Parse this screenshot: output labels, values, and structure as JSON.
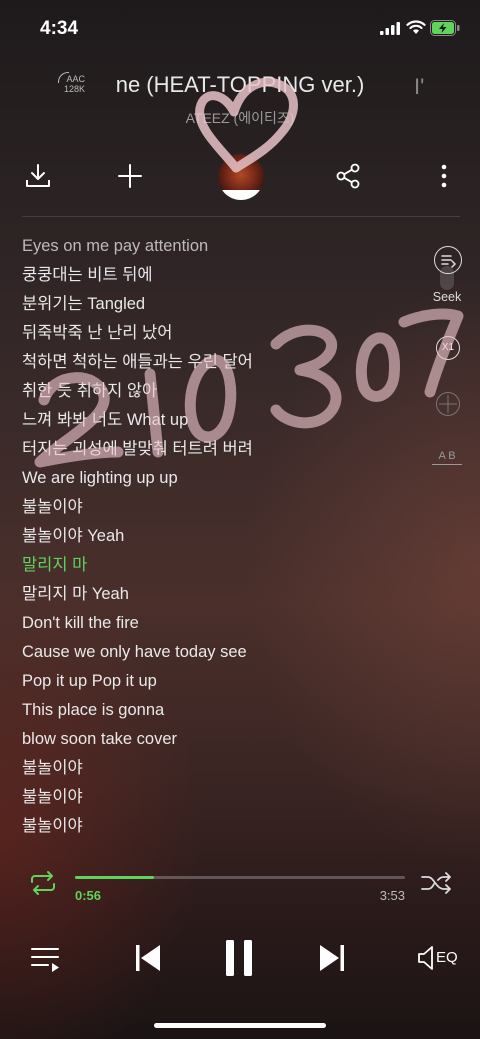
{
  "status_bar": {
    "time": "4:34"
  },
  "header": {
    "codec_line1": "AAC",
    "codec_line2": "128K",
    "title": "ne (HEAT-TOPPING ver.)",
    "title_fragment": "I'",
    "artist": "ATEEZ (에이티즈)"
  },
  "toolbar": {
    "download_icon": "download-icon",
    "add_icon": "plus-icon",
    "share_icon": "share-icon",
    "more_icon": "more-vertical-icon"
  },
  "lyrics": [
    "Eyes on me pay attention",
    "쿵쿵대는 비트 뒤에",
    "분위기는 Tangled",
    "뒤죽박죽 난 난리 났어",
    "척하면 척하는 애들과는 우린 달어",
    "취한 듯 취하지 않아",
    "느껴 봐봐 너도 What up",
    "터지는 괴성에 발맞춰 터트려 버려",
    "We are lighting up up",
    "불놀이야",
    "불놀이야 Yeah",
    "말리지 마",
    "말리지 마 Yeah",
    "Don't kill the fire",
    "Cause we only have today see",
    "Pop it up Pop it up",
    "This place is gonna",
    "blow soon take cover",
    "불놀이야",
    "불놀이야",
    "불놀이야"
  ],
  "active_lyric_index": 11,
  "side_controls": {
    "seek_label": "Seek",
    "speed_label": "X1",
    "ab_label": "A B"
  },
  "player": {
    "elapsed": "0:56",
    "duration": "3:53",
    "progress_fraction": 0.24,
    "eq_label": "EQ"
  },
  "colors": {
    "accent": "#5fd35c",
    "overlay_ink": "#e8c3c8"
  }
}
